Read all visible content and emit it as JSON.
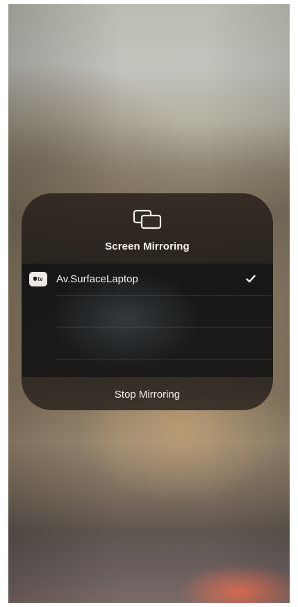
{
  "panel": {
    "icon": "screen-mirroring-icon",
    "title": "Screen Mirroring"
  },
  "devices": [
    {
      "badge_icon": "apple-tv-icon",
      "badge_text": "tv",
      "name": "Av.SurfaceLaptop",
      "selected": true,
      "check_icon": "checkmark-icon"
    }
  ],
  "footer": {
    "stop_label": "Stop Mirroring"
  },
  "colors": {
    "panel_bg": "#2a241f",
    "text": "#f2f2f2",
    "badge_bg": "#efe9e6",
    "warm_blur_accent": "#e26e52"
  }
}
